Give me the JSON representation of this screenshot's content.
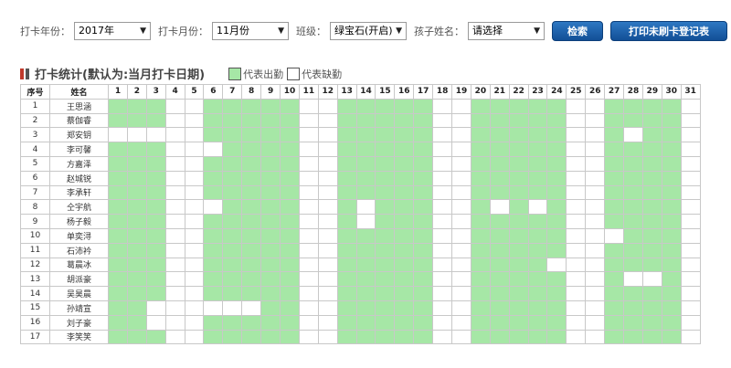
{
  "filters": {
    "year_label": "打卡年份：",
    "year_value": "2017年",
    "month_label": "打卡月份：",
    "month_value": "11月份",
    "class_label": "班级：",
    "class_value": "绿宝石(开启)",
    "child_label": "孩子姓名：",
    "child_value": "请选择",
    "search_button": "检索",
    "print_button": "打印未刷卡登记表"
  },
  "section": {
    "title": "打卡统计(默认为:当月打卡日期)",
    "legend_present": "代表出勤",
    "legend_absent": "代表缺勤",
    "colors": {
      "present": "#a6e7a6",
      "absent": "#ffffff"
    }
  },
  "table": {
    "col_index": "序号",
    "col_name": "姓名",
    "days": [
      "1",
      "2",
      "3",
      "4",
      "5",
      "6",
      "7",
      "8",
      "9",
      "10",
      "11",
      "12",
      "13",
      "14",
      "15",
      "16",
      "17",
      "18",
      "19",
      "20",
      "21",
      "22",
      "23",
      "24",
      "25",
      "26",
      "27",
      "28",
      "29",
      "30",
      "31"
    ],
    "rows": [
      {
        "index": "1",
        "name": "王思涵",
        "att": [
          1,
          1,
          1,
          0,
          0,
          1,
          1,
          1,
          1,
          1,
          0,
          0,
          1,
          1,
          1,
          1,
          1,
          0,
          0,
          1,
          1,
          1,
          1,
          1,
          0,
          0,
          1,
          1,
          1,
          1,
          0
        ]
      },
      {
        "index": "2",
        "name": "蔡伽睿",
        "att": [
          1,
          1,
          1,
          0,
          0,
          1,
          1,
          1,
          1,
          1,
          0,
          0,
          1,
          1,
          1,
          1,
          1,
          0,
          0,
          1,
          1,
          1,
          1,
          1,
          0,
          0,
          1,
          1,
          1,
          1,
          0
        ]
      },
      {
        "index": "3",
        "name": "郑安钥",
        "att": [
          0,
          0,
          0,
          0,
          0,
          1,
          1,
          1,
          1,
          1,
          0,
          0,
          1,
          1,
          1,
          1,
          1,
          0,
          0,
          1,
          1,
          1,
          1,
          1,
          0,
          0,
          1,
          0,
          1,
          1,
          0
        ]
      },
      {
        "index": "4",
        "name": "李可馨",
        "att": [
          1,
          1,
          1,
          0,
          0,
          0,
          1,
          1,
          1,
          1,
          0,
          0,
          1,
          1,
          1,
          1,
          1,
          0,
          0,
          1,
          1,
          1,
          1,
          1,
          0,
          0,
          1,
          1,
          1,
          1,
          0
        ]
      },
      {
        "index": "5",
        "name": "方嘉泽",
        "att": [
          1,
          1,
          1,
          0,
          0,
          1,
          1,
          1,
          1,
          1,
          0,
          0,
          1,
          1,
          1,
          1,
          1,
          0,
          0,
          1,
          1,
          1,
          1,
          1,
          0,
          0,
          1,
          1,
          1,
          1,
          0
        ]
      },
      {
        "index": "6",
        "name": "赵城锐",
        "att": [
          1,
          1,
          1,
          0,
          0,
          1,
          1,
          1,
          1,
          1,
          0,
          0,
          1,
          1,
          1,
          1,
          1,
          0,
          0,
          1,
          1,
          1,
          1,
          1,
          0,
          0,
          1,
          1,
          1,
          1,
          0
        ]
      },
      {
        "index": "7",
        "name": "李承轩",
        "att": [
          1,
          1,
          1,
          0,
          0,
          1,
          1,
          1,
          1,
          1,
          0,
          0,
          1,
          1,
          1,
          1,
          1,
          0,
          0,
          1,
          1,
          1,
          1,
          1,
          0,
          0,
          1,
          1,
          1,
          1,
          0
        ]
      },
      {
        "index": "8",
        "name": "仝宇航",
        "att": [
          1,
          1,
          1,
          0,
          0,
          0,
          1,
          1,
          1,
          1,
          0,
          0,
          1,
          0,
          1,
          1,
          1,
          0,
          0,
          1,
          0,
          1,
          0,
          1,
          0,
          0,
          1,
          1,
          1,
          1,
          0
        ]
      },
      {
        "index": "9",
        "name": "杨子毅",
        "att": [
          1,
          1,
          1,
          0,
          0,
          1,
          1,
          1,
          1,
          1,
          0,
          0,
          1,
          0,
          1,
          1,
          1,
          0,
          0,
          1,
          1,
          1,
          1,
          1,
          0,
          0,
          1,
          1,
          1,
          1,
          0
        ]
      },
      {
        "index": "10",
        "name": "单奕浔",
        "att": [
          1,
          1,
          1,
          0,
          0,
          1,
          1,
          1,
          1,
          1,
          0,
          0,
          1,
          1,
          1,
          1,
          1,
          0,
          0,
          1,
          1,
          1,
          1,
          1,
          0,
          0,
          0,
          1,
          1,
          1,
          0
        ]
      },
      {
        "index": "11",
        "name": "石沛衿",
        "att": [
          1,
          1,
          1,
          0,
          0,
          1,
          1,
          1,
          1,
          1,
          0,
          0,
          1,
          1,
          1,
          1,
          1,
          0,
          0,
          1,
          1,
          1,
          1,
          1,
          0,
          0,
          1,
          1,
          1,
          1,
          0
        ]
      },
      {
        "index": "12",
        "name": "葛晨冰",
        "att": [
          1,
          1,
          1,
          0,
          0,
          1,
          1,
          1,
          1,
          1,
          0,
          0,
          1,
          1,
          1,
          1,
          1,
          0,
          0,
          1,
          1,
          1,
          1,
          0,
          0,
          0,
          1,
          1,
          1,
          1,
          0
        ]
      },
      {
        "index": "13",
        "name": "胡派豪",
        "att": [
          1,
          1,
          1,
          0,
          0,
          1,
          1,
          1,
          1,
          1,
          0,
          0,
          1,
          1,
          1,
          1,
          1,
          0,
          0,
          1,
          1,
          1,
          1,
          1,
          0,
          0,
          1,
          0,
          0,
          1,
          0
        ]
      },
      {
        "index": "14",
        "name": "吴昊晨",
        "att": [
          1,
          1,
          1,
          0,
          0,
          1,
          1,
          1,
          1,
          1,
          0,
          0,
          1,
          1,
          1,
          1,
          1,
          0,
          0,
          1,
          1,
          1,
          1,
          1,
          0,
          0,
          1,
          1,
          1,
          1,
          0
        ]
      },
      {
        "index": "15",
        "name": "孙靖宣",
        "att": [
          1,
          1,
          0,
          0,
          0,
          0,
          0,
          0,
          1,
          1,
          0,
          0,
          1,
          1,
          1,
          1,
          1,
          0,
          0,
          1,
          1,
          1,
          1,
          1,
          0,
          0,
          1,
          1,
          1,
          1,
          0
        ]
      },
      {
        "index": "16",
        "name": "刘子豪",
        "att": [
          1,
          1,
          0,
          0,
          0,
          1,
          1,
          1,
          1,
          1,
          0,
          0,
          1,
          1,
          1,
          1,
          1,
          0,
          0,
          1,
          1,
          1,
          1,
          1,
          0,
          0,
          1,
          1,
          1,
          1,
          0
        ]
      },
      {
        "index": "17",
        "name": "李笑笑",
        "att": [
          1,
          1,
          1,
          0,
          0,
          1,
          1,
          1,
          1,
          1,
          0,
          0,
          1,
          1,
          1,
          1,
          1,
          0,
          0,
          1,
          1,
          1,
          1,
          1,
          0,
          0,
          1,
          1,
          1,
          1,
          0
        ]
      }
    ]
  }
}
